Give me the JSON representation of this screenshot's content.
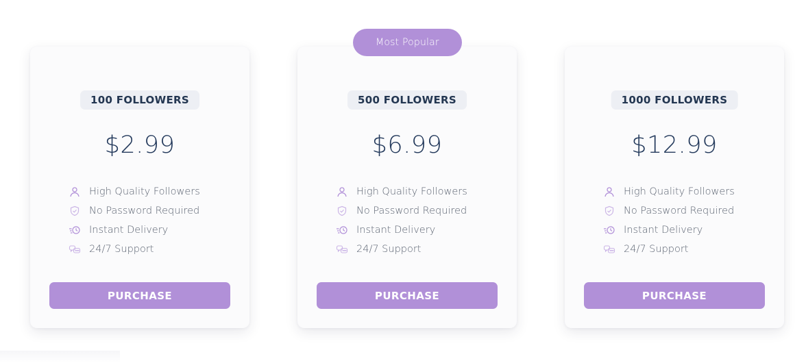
{
  "badge": {
    "label": "Most Popular"
  },
  "colors": {
    "accent": "#b190d8",
    "heading": "#243a5c",
    "tier_bg": "#edeff4",
    "card_bg": "#fbfbfc",
    "feature_text": "#5c6472"
  },
  "plans": [
    {
      "tier": "100 FOLLOWERS",
      "price": "$2.99",
      "features": [
        {
          "icon": "user-icon",
          "label": "High Quality Followers"
        },
        {
          "icon": "shield-check-icon",
          "label": "No Password Required"
        },
        {
          "icon": "fast-clock-icon",
          "label": "Instant Delivery"
        },
        {
          "icon": "support-chat-icon",
          "label": "24/7 Support"
        }
      ],
      "button": "PURCHASE"
    },
    {
      "tier": "500 FOLLOWERS",
      "price": "$6.99",
      "features": [
        {
          "icon": "user-icon",
          "label": "High Quality Followers"
        },
        {
          "icon": "shield-check-icon",
          "label": "No Password Required"
        },
        {
          "icon": "fast-clock-icon",
          "label": "Instant Delivery"
        },
        {
          "icon": "support-chat-icon",
          "label": "24/7 Support"
        }
      ],
      "button": "PURCHASE"
    },
    {
      "tier": "1000 FOLLOWERS",
      "price": "$12.99",
      "features": [
        {
          "icon": "user-icon",
          "label": "High Quality Followers"
        },
        {
          "icon": "shield-check-icon",
          "label": "No Password Required"
        },
        {
          "icon": "fast-clock-icon",
          "label": "Instant Delivery"
        },
        {
          "icon": "support-chat-icon",
          "label": "24/7 Support"
        }
      ],
      "button": "PURCHASE"
    }
  ]
}
